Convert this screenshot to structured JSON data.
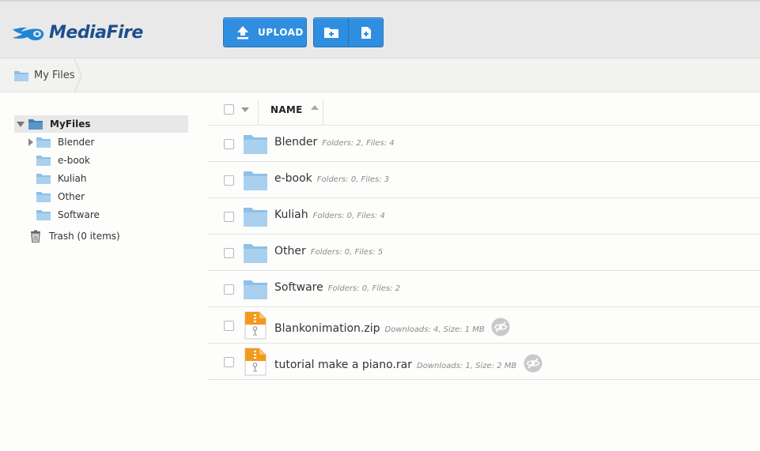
{
  "brand": {
    "logo_text": "MediaFire",
    "color": "#1d4f8c"
  },
  "toolbar": {
    "upload_label": "UPLOAD",
    "upload_icon": "upload-arrow-icon",
    "new_folder_icon": "new-folder-icon",
    "new_file_icon": "new-file-icon",
    "accent": "#2f8ee0"
  },
  "breadcrumb": {
    "current": "My Files"
  },
  "sidebar": {
    "root": "MyFiles",
    "items": [
      {
        "label": "Blender",
        "has_children": true
      },
      {
        "label": "e-book",
        "has_children": false
      },
      {
        "label": "Kuliah",
        "has_children": false
      },
      {
        "label": "Other",
        "has_children": false
      },
      {
        "label": "Software",
        "has_children": false
      }
    ],
    "trash": "Trash (0 items)"
  },
  "list": {
    "header": {
      "name": "NAME"
    },
    "rows": [
      {
        "type": "folder",
        "name": "Blender",
        "meta": "Folders: 2, Files: 4"
      },
      {
        "type": "folder",
        "name": "e-book",
        "meta": "Folders: 0, Files: 3"
      },
      {
        "type": "folder",
        "name": "Kuliah",
        "meta": "Folders: 0, Files: 4"
      },
      {
        "type": "folder",
        "name": "Other",
        "meta": "Folders: 0, Files: 5"
      },
      {
        "type": "folder",
        "name": "Software",
        "meta": "Folders: 0, Files: 2"
      },
      {
        "type": "zip",
        "name": "Blankonimation.zip",
        "meta": "Downloads: 4, Size: 1 MB",
        "privacy_icon": "private-eye-icon"
      },
      {
        "type": "zip",
        "name": "tutorial make a piano.rar",
        "meta": "Downloads: 1, Size: 2 MB",
        "privacy_icon": "private-eye-icon"
      }
    ]
  }
}
